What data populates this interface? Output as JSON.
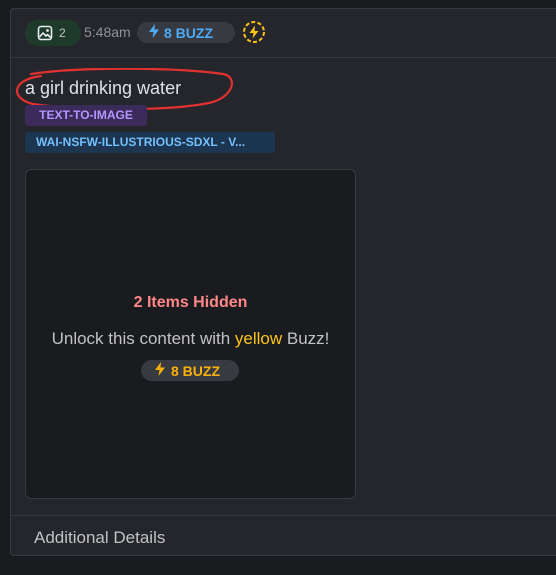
{
  "header": {
    "image_count": "2",
    "time": "5:48am",
    "buzz": "8 BUZZ"
  },
  "prompt": "a girl drinking water",
  "badges": {
    "type": "TEXT-TO-IMAGE",
    "model": "WAI-NSFW-ILLUSTRIOUS-SDXL - V..."
  },
  "locked": {
    "title": "2 Items Hidden",
    "text_before": "Unlock this content with ",
    "text_highlight": "yellow",
    "text_after": " Buzz!",
    "buzz": "8 BUZZ"
  },
  "footer": {
    "label": "Additional Details"
  },
  "icons": [
    "image-icon",
    "lightning-icon",
    "tip-icon"
  ],
  "colors": {
    "accent_blue": "#4dabf7",
    "warning_red": "#ff8787",
    "buzz_yellow": "#fab005",
    "purple": "#b197fc",
    "annotation_red": "#e03131"
  }
}
